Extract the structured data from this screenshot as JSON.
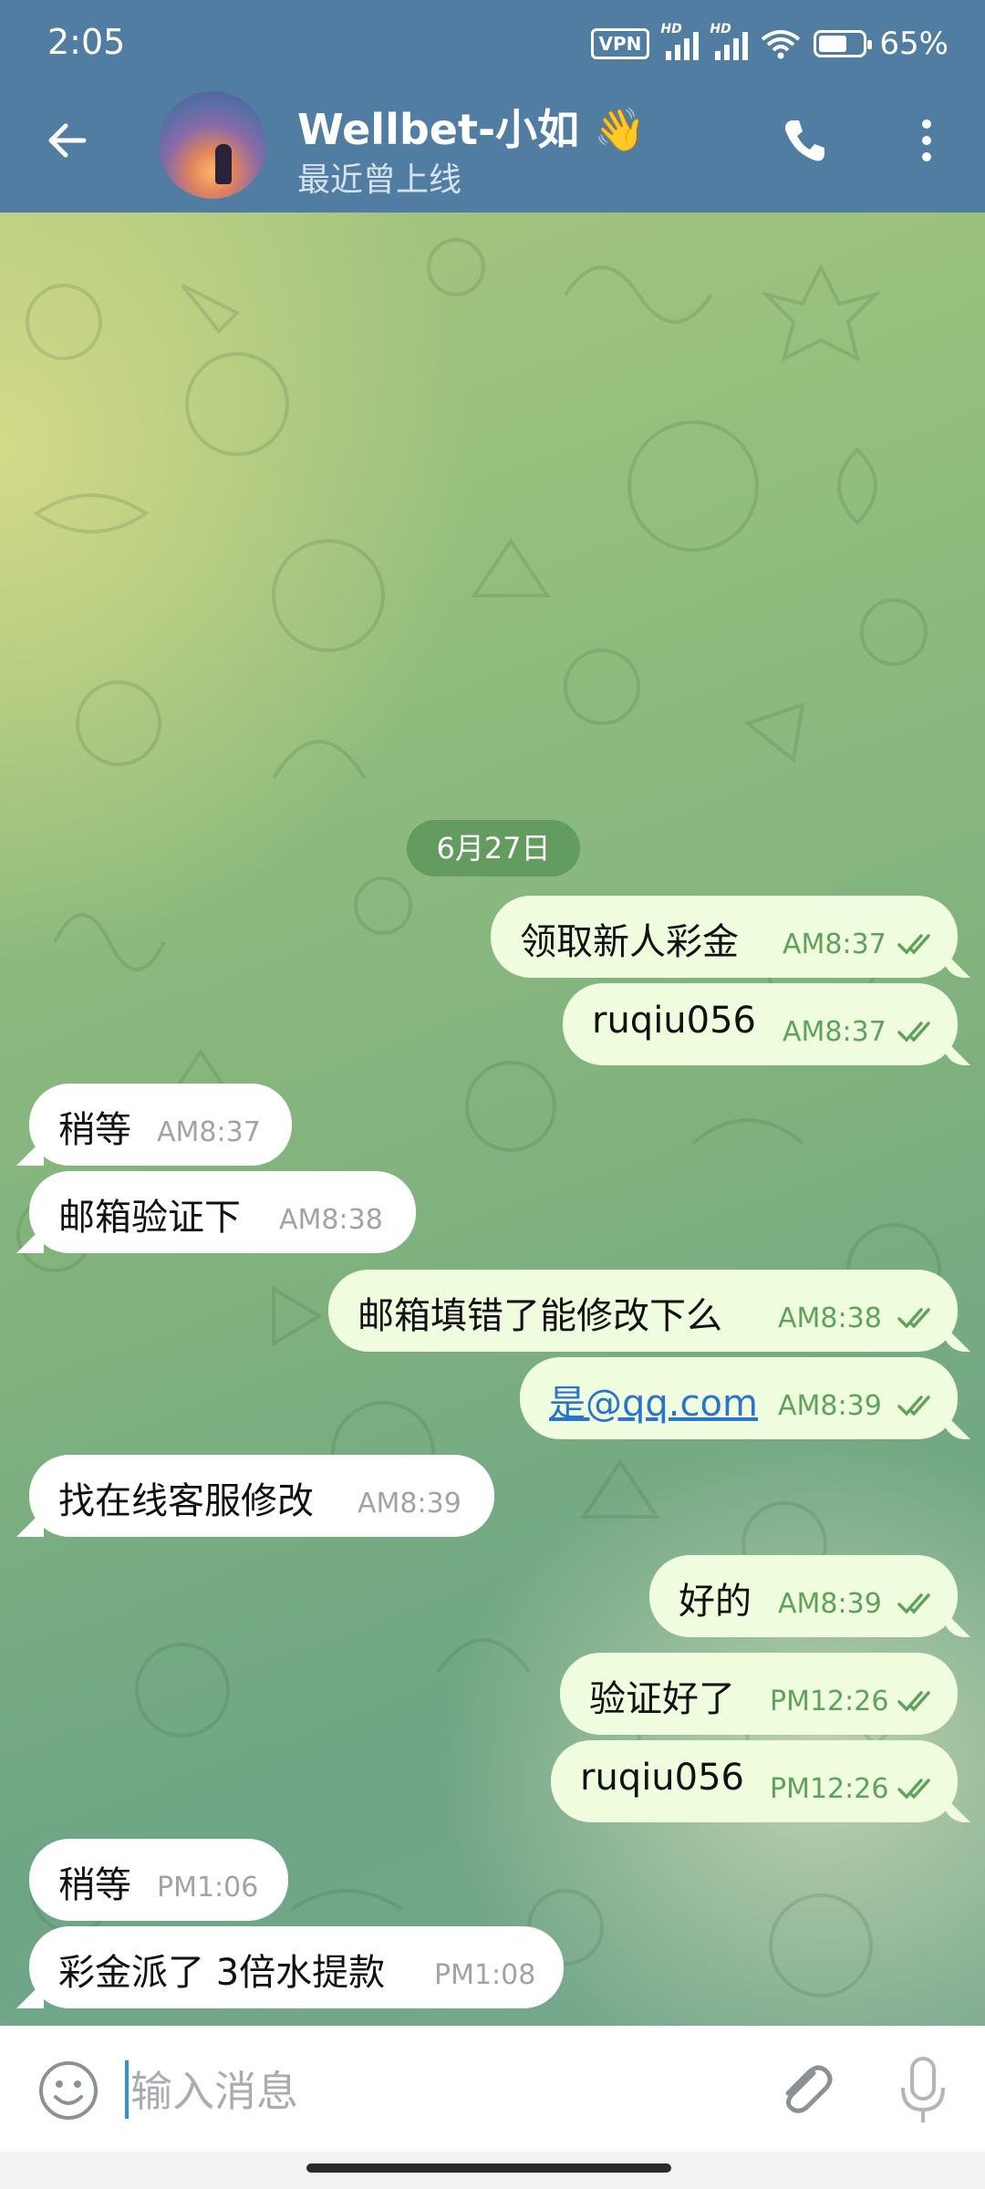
{
  "status_bar": {
    "time": "2:05",
    "vpn": "VPN",
    "signal_hd": "HD",
    "battery": "65%",
    "battery_level": 0.65
  },
  "header": {
    "title": "Wellbet-小如 👋",
    "subtitle": "最近曾上线"
  },
  "chat": {
    "date": "6月27日",
    "messages": [
      {
        "dir": "out",
        "text": "领取新人彩金",
        "time": "AM8:37"
      },
      {
        "dir": "out",
        "text": "ruqiu056",
        "time": "AM8:37"
      },
      {
        "dir": "in",
        "text": "稍等",
        "time": "AM8:37"
      },
      {
        "dir": "in",
        "text": "邮箱验证下",
        "time": "AM8:38"
      },
      {
        "dir": "out",
        "text": "邮箱填错了能修改下么",
        "time": "AM8:38"
      },
      {
        "dir": "out",
        "text": "是@qq.com",
        "time": "AM8:39"
      },
      {
        "dir": "in",
        "text": "找在线客服修改",
        "time": "AM8:39"
      },
      {
        "dir": "out",
        "text": "好的",
        "time": "AM8:39"
      },
      {
        "dir": "out",
        "text": "验证好了",
        "time": "PM12:26"
      },
      {
        "dir": "out",
        "text": "ruqiu056",
        "time": "PM12:26"
      },
      {
        "dir": "in",
        "text": "稍等",
        "time": "PM1:06"
      },
      {
        "dir": "in",
        "text": "彩金派了 3倍水提款",
        "time": "PM1:08"
      }
    ]
  },
  "input": {
    "placeholder": "输入消息"
  },
  "colors": {
    "header": "#517da2",
    "outgoing_bubble": "#effdde",
    "incoming_bubble": "#ffffff",
    "check": "#5fa35b"
  },
  "icons": [
    "back-arrow-icon",
    "phone-icon",
    "more-vert-icon",
    "double-check-icon",
    "emoji-icon",
    "attach-icon",
    "mic-icon"
  ]
}
